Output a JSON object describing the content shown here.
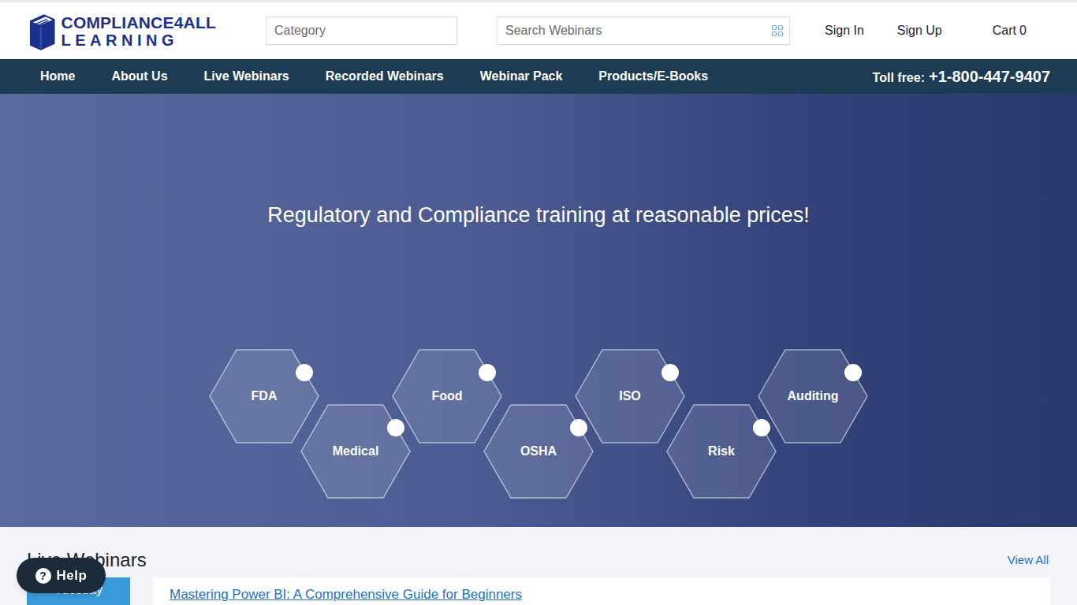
{
  "logo": {
    "line1": "COMPLIANCE4ALL",
    "line2": "LEARNING"
  },
  "category": {
    "placeholder": "Category"
  },
  "search": {
    "placeholder": "Search Webinars"
  },
  "account": [
    "Sign In",
    "Sign Up"
  ],
  "cart": {
    "label": "Cart",
    "count": "0"
  },
  "nav": [
    {
      "label": "Home",
      "selected": false
    },
    {
      "label": "About Us",
      "selected": false
    },
    {
      "label": "Live Webinars",
      "selected": false
    },
    {
      "label": "Recorded Webinars",
      "selected": false
    },
    {
      "label": "Webinar Pack",
      "selected": false
    },
    {
      "label": "Products/E-Books",
      "selected": false
    }
  ],
  "tollfree": {
    "label": "Toll free:",
    "number": "+1-800-447-9407"
  },
  "hero": {
    "headline": "Regulatory and Compliance training at reasonable prices!",
    "topics": [
      "FDA",
      "Medical",
      "Food",
      "OSHA",
      "ISO",
      "Risk",
      "Auditing"
    ]
  },
  "live": {
    "title": "Live Webinars",
    "view_all": "View All",
    "items": [
      {
        "day": "Tuesday",
        "title": "Mastering Power BI: A Comprehensive Guide for Beginners"
      }
    ]
  },
  "help": {
    "icon": "?",
    "label": "Help"
  }
}
